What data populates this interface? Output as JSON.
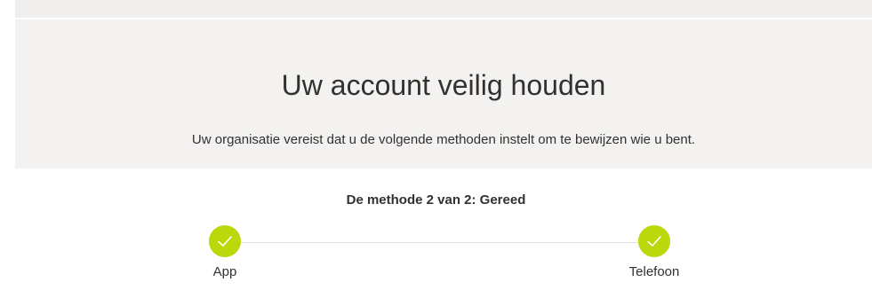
{
  "header": {
    "title": "Uw account veilig houden",
    "subtitle": "Uw organisatie vereist dat u de volgende methoden instelt om te bewijzen wie u bent."
  },
  "progress": {
    "status_text": "De methode 2 van 2: Gereed",
    "completed_steps": 2,
    "total_steps": 2,
    "steps": [
      {
        "label": "App",
        "state": "completed",
        "icon": "checkmark-icon"
      },
      {
        "label": "Telefoon",
        "state": "completed",
        "icon": "checkmark-icon"
      }
    ]
  },
  "colors": {
    "header_background": "#f3f2f1",
    "step_completed": "#bad80a",
    "progress_line": "#e1dfdd",
    "text": "#323130"
  }
}
